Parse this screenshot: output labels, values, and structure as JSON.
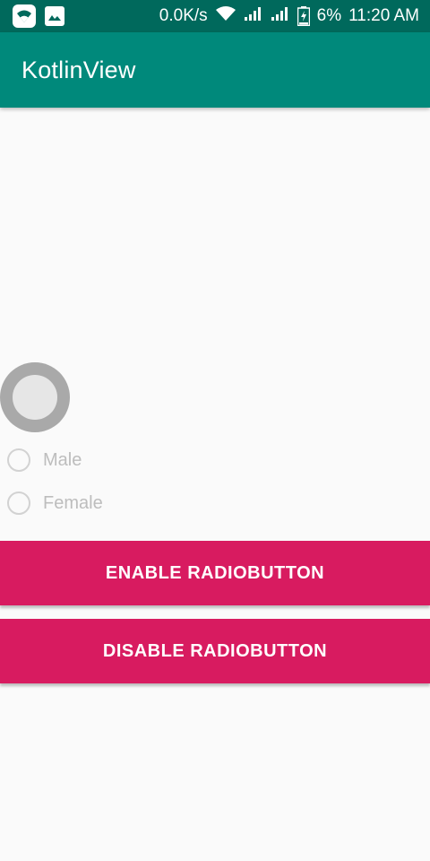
{
  "status_bar": {
    "network_speed": "0.0K/s",
    "battery_percent": "6%",
    "time": "11:20 AM",
    "left_icons": [
      "wifi-status-icon",
      "image-icon"
    ],
    "right_icons": [
      "wifi-icon",
      "signal-icon",
      "signal-icon",
      "battery-charging-icon"
    ]
  },
  "app_bar": {
    "title": "KotlinView",
    "color": "#00897b"
  },
  "radio_group": {
    "options": [
      {
        "label": "Male",
        "checked": false,
        "enabled": false
      },
      {
        "label": "Female",
        "checked": false,
        "enabled": false
      }
    ]
  },
  "buttons": {
    "enable_label": "ENABLE RADIOBUTTON",
    "disable_label": "DISABLE RADIOBUTTON",
    "color": "#d81b60"
  },
  "colors": {
    "status_bar": "#00695c",
    "app_bar": "#00897b",
    "accent": "#d81b60",
    "background": "#fafafa"
  }
}
